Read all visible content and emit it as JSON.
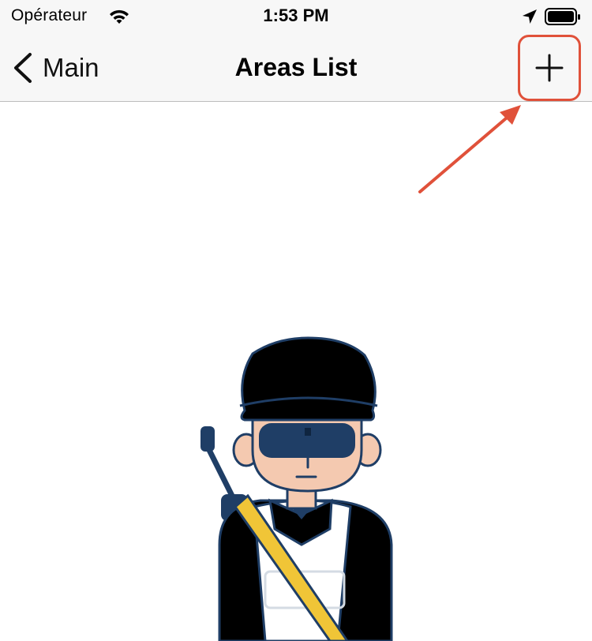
{
  "status_bar": {
    "carrier": "Opérateur",
    "time": "1:53 PM",
    "icons": [
      "wifi-icon",
      "location-arrow-icon",
      "battery-icon"
    ]
  },
  "nav_bar": {
    "back_label": "Main",
    "title": "Areas List",
    "add_icon": "plus-icon"
  },
  "annotation": {
    "highlight_color": "#e0513a",
    "highlight_target": "add-button"
  },
  "empty_state": {
    "illustration": "security-guard-illustration"
  },
  "colors": {
    "nav_background": "#f7f7f7",
    "accent_navy": "#1f3e66",
    "annotation_red": "#e0513a"
  }
}
